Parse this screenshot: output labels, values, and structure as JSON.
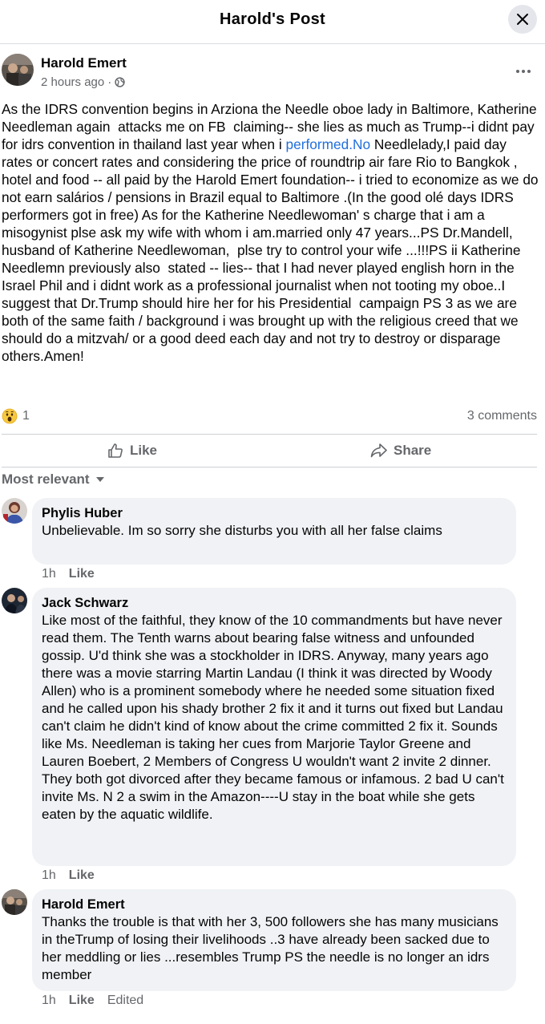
{
  "header": {
    "title": "Harold's Post"
  },
  "post": {
    "author": "Harold Emert",
    "time": "2 hours ago",
    "separator": "·",
    "body_before_link": "As the IDRS convention begins in Arziona the Needle oboe lady in Baltimore, Katherine Needleman again  attacks me on FB  claiming-- she lies as much as Trump--i didnt pay  for idrs convention in thailand last year when i ",
    "link_text": "performed.No",
    "body_after_link": " Needlelady,I paid day rates or concert rates and considering the price of roundtrip air fare Rio to Bangkok , hotel and food -- all paid by the Harold Emert foundation-- i tried to economize as we do not earn salários / pensions in Brazil equal to Baltimore .(In the good olé days IDRS performers got in free) As for the Katherine Needlewoman' s charge that i am a misogynist plse ask my wife with whom i am.married only 47 years...PS Dr.Mandell, husband of Katherine Needlewoman,  plse try to control your wife ...!!!PS ii Katherine Needlemn previously also  stated -- lies-- that I had never played english horn in the Israel Phil and i didnt work as a professional journalist when not tooting my oboe..I suggest that Dr.Trump should hire her for his Presidential  campaign PS 3 as we are both of the same faith / background i was brought up with the religious creed that we should do a mitzvah/ or a good deed each day and not try to destroy or disparage others.Amen!",
    "reaction_count": "1",
    "comment_count": "3 comments"
  },
  "actions": {
    "like": "Like",
    "share": "Share"
  },
  "sort": {
    "label": "Most relevant"
  },
  "comments": [
    {
      "name": "Phylis Huber",
      "text": "Unbelievable. Im so sorry she disturbs you with all her false claims",
      "time": "1h",
      "like": "Like",
      "edited": ""
    },
    {
      "name": "Jack Schwarz",
      "text": "Like most of the faithful, they know of the 10 commandments but have never read them. The Tenth warns about bearing false witness and unfounded gossip. U'd think she was a stockholder in IDRS. Anyway, many years ago there was a movie starring Martin Landau (I think it was directed by Woody Allen) who is a prominent somebody where he needed some situation fixed and he called upon his shady brother 2 fix it and it turns out fixed but Landau can't claim he didn't kind of know about the crime committed 2 fix it. Sounds like Ms. Needleman is taking her cues from Marjorie Taylor Greene and Lauren Boebert, 2 Members of Congress U wouldn't want 2 invite 2 dinner. They both got divorced after they became famous or infamous. 2 bad U can't invite Ms. N 2 a swim in the Amazon----U stay in the boat while she gets eaten by the aquatic wildlife.",
      "time": "1h",
      "like": "Like",
      "edited": ""
    },
    {
      "name": "Harold Emert",
      "text": "Thanks the trouble is that with her 3, 500 followers she has many musicians in theTrump of losing their livelihoods ..3 have already been sacked due to her meddling or lies ...resembles Trump PS the needle is no longer an idrs member",
      "time": "1h",
      "like": "Like",
      "edited": "Edited"
    }
  ],
  "colors": {
    "link": "#216fdb",
    "muted": "#65676b",
    "bubble": "#f0f2f5",
    "divider": "#ced0d4"
  }
}
